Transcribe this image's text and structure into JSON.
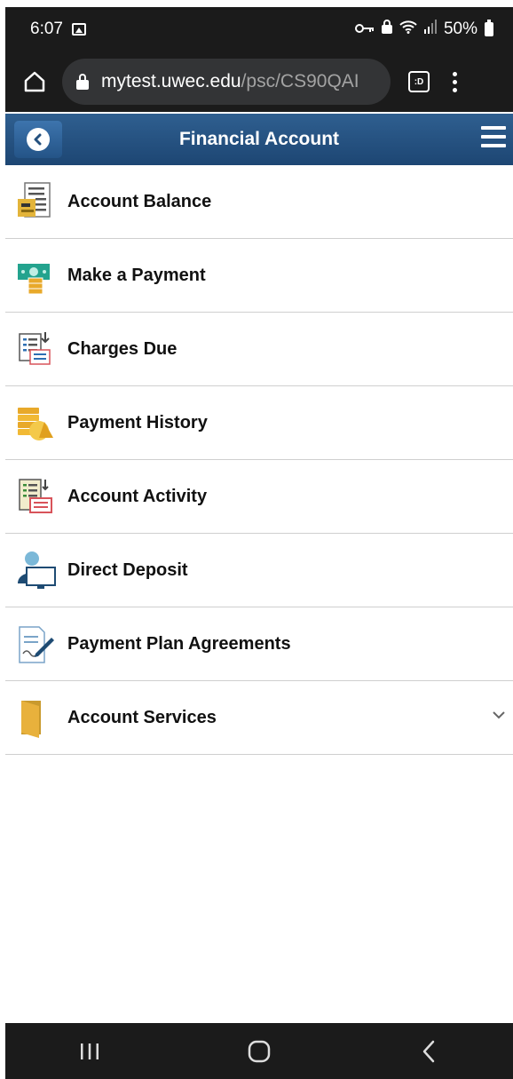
{
  "status_bar": {
    "time": "6:07",
    "battery_text": "50%",
    "icons": [
      "image-icon",
      "key-icon",
      "lock-icon",
      "wifi-icon",
      "signal-icon",
      "battery-icon"
    ]
  },
  "browser": {
    "url_domain": "mytest.uwec.edu",
    "url_path": "/psc/CS90QAI",
    "tab_count": ":D"
  },
  "header": {
    "title": "Financial Account",
    "color": "#24507e"
  },
  "menu": {
    "items": [
      {
        "label": "Account Balance",
        "icon": "account-balance-icon"
      },
      {
        "label": "Make a Payment",
        "icon": "make-payment-icon"
      },
      {
        "label": "Charges Due",
        "icon": "charges-due-icon"
      },
      {
        "label": "Payment History",
        "icon": "payment-history-icon"
      },
      {
        "label": "Account Activity",
        "icon": "account-activity-icon"
      },
      {
        "label": "Direct Deposit",
        "icon": "direct-deposit-icon"
      },
      {
        "label": "Payment Plan Agreements",
        "icon": "payment-plan-icon"
      },
      {
        "label": "Account Services",
        "icon": "folder-icon",
        "expandable": true
      }
    ]
  },
  "nav_bar": {
    "buttons": [
      "recent-apps-icon",
      "home-icon",
      "back-icon"
    ]
  }
}
